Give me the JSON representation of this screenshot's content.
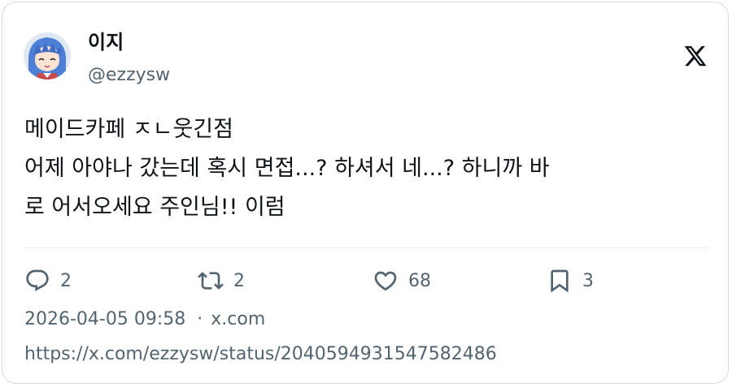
{
  "author": {
    "display_name": "이지",
    "handle": "@ezzysw",
    "avatar_icon": "anime-avatar-icon"
  },
  "brand_icon": "x-logo-icon",
  "tweet": {
    "lines": [
      "메이드카페 ㅈㄴ웃긴점",
      "어제 아야나 갔는데 혹시 면접...? 하셔서 네...? 하니까 바",
      "로 어서오세요 주인님!! 이럼"
    ]
  },
  "actions": {
    "reply": {
      "icon": "reply-icon",
      "count": "2"
    },
    "retweet": {
      "icon": "retweet-icon",
      "count": "2"
    },
    "like": {
      "icon": "heart-icon",
      "count": "68"
    },
    "bookmark": {
      "icon": "bookmark-icon",
      "count": "3"
    }
  },
  "meta": {
    "timestamp": "2026-04-05 09:58",
    "separator": "·",
    "source": "x.com"
  },
  "status_url": "https://x.com/ezzysw/status/2040594931547582486"
}
